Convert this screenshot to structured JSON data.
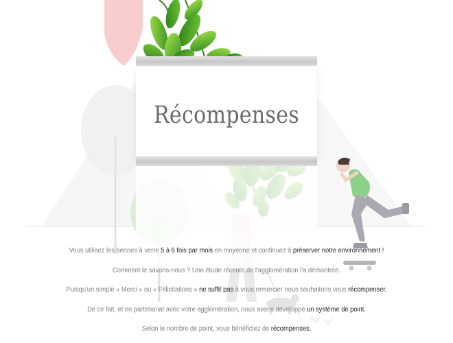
{
  "banner": {
    "title": "Récompenses"
  },
  "paragraphs": [
    {
      "parts": [
        {
          "text": "Vous utilisez les bennes à verre ",
          "strong": false
        },
        {
          "text": "5 à 6 fois par mois",
          "strong": true
        },
        {
          "text": " en moyenne et continuez à ",
          "strong": false
        },
        {
          "text": "préserver notre environnement !",
          "strong": true
        }
      ]
    },
    {
      "parts": [
        {
          "text": "Comment le savons-nous ? Une étude récente de l'agglomération l'a démontrée.",
          "strong": false
        }
      ]
    },
    {
      "parts": [
        {
          "text": "Puisqu'un simple « Merci » ou « Félicitations » ",
          "strong": false
        },
        {
          "text": "ne suffit pas",
          "strong": true
        },
        {
          "text": " à vous remercier nous souhaitons vous ",
          "strong": false
        },
        {
          "text": "récompenser.",
          "strong": true
        }
      ]
    },
    {
      "parts": [
        {
          "text": "De ce fait, et en partenariat avec votre agglomération, nous avons développé ",
          "strong": false
        },
        {
          "text": "un système de point.",
          "strong": true
        }
      ]
    },
    {
      "parts": [
        {
          "text": "Selon le nombre de point, vous bénéficiez de ",
          "strong": false
        },
        {
          "text": "récompenses.",
          "strong": true
        }
      ]
    }
  ],
  "illustration": {
    "subjects": [
      "leaves-icon",
      "tree-icon",
      "person-walking-dog-icon",
      "skateboarder-icon"
    ],
    "colors": {
      "leaf_dark": "#2f8a1f",
      "leaf_light": "#8cd43a",
      "tree_red": "#f2b8b8",
      "tree_green": "#c9e6c4",
      "shirt_green": "#6bbf6a",
      "pants_gray": "#6d6d78",
      "text_gray": "#7f7f7f",
      "text_strong": "#1e1e1e"
    }
  }
}
